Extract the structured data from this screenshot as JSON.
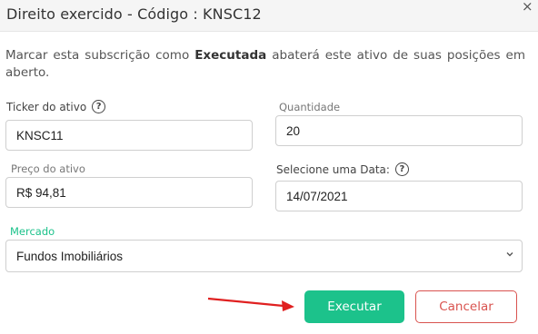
{
  "dialog": {
    "title": "Direito exercido - Código : KNSC12",
    "close_label": "×",
    "description": {
      "before": "Marcar esta subscrição como ",
      "bold": "Executada",
      "after": " abaterá este ativo de suas posições em aberto."
    }
  },
  "form": {
    "ticker": {
      "label": "Ticker do ativo",
      "value": "KNSC11"
    },
    "quantidade": {
      "label": "Quantidade",
      "value": "20"
    },
    "preco": {
      "label": "Preço do ativo",
      "value": "R$ 94,81"
    },
    "data": {
      "label": "Selecione uma Data:",
      "value": "14/07/2021"
    },
    "mercado": {
      "label": "Mercado",
      "value": "Fundos Imobiliários"
    },
    "help_glyph": "?"
  },
  "actions": {
    "execute_label": "Executar",
    "cancel_label": "Cancelar"
  },
  "colors": {
    "accent": "#1cc28b",
    "danger": "#d9534f",
    "arrow": "#e02020"
  },
  "icons": {
    "close": "close-icon",
    "help": "question-circle-icon",
    "dropdown": "chevron-down-icon",
    "arrow": "red-arrow-annotation"
  }
}
